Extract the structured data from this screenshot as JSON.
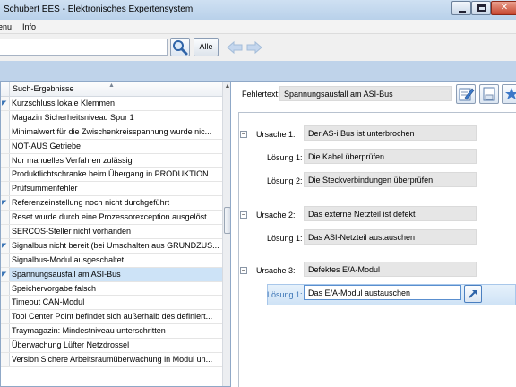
{
  "window": {
    "title": "Schubert EES - Elektronisches Expertensystem"
  },
  "menu": {
    "items": [
      "enu",
      "Info"
    ]
  },
  "toolbar": {
    "search_value": "",
    "all_label": "Alle"
  },
  "list": {
    "header": "Such-Ergebnisse",
    "items": [
      "Kurzschluss lokale Klemmen",
      "Magazin Sicherheitsniveau Spur 1",
      "Minimalwert für die Zwischenkreisspannung wurde nic...",
      "NOT-AUS Getriebe",
      "Nur manuelles Verfahren zulässig",
      "Produktlichtschranke beim Übergang in PRODUKTION...",
      "Prüfsummenfehler",
      "Referenzeinstellung noch nicht durchgeführt",
      "Reset wurde durch eine Prozessorexception ausgelöst",
      "SERCOS-Steller nicht vorhanden",
      "Signalbus nicht bereit (bei Umschalten aus GRUNDZUS...",
      "Signalbus-Modul ausgeschaltet",
      "Spannungsausfall am ASI-Bus",
      "Speichervorgabe falsch",
      "Timeout CAN-Modul",
      "Tool Center Point befindet sich außerhalb des definiert...",
      "Traymagazin: Mindestniveau unterschritten",
      "Überwachung Lüfter Netzdrossel",
      "Version Sichere Arbeitsraumüberwachung in Modul un..."
    ],
    "selected_index": 12
  },
  "detail": {
    "fehlertext_label": "Fehlertext:",
    "fehlertext_value": "Spannungsausfall am ASI-Bus",
    "causes": [
      {
        "label": "Ursache 1:",
        "value": "Der AS-i Bus ist unterbrochen",
        "solutions": [
          {
            "label": "Lösung 1:",
            "value": "Die Kabel überprüfen"
          },
          {
            "label": "Lösung 2:",
            "value": "Die Steckverbindungen überprüfen"
          }
        ]
      },
      {
        "label": "Ursache 2:",
        "value": "Das externe Netzteil ist defekt",
        "solutions": [
          {
            "label": "Lösung 1:",
            "value": "Das ASI-Netzteil austauschen"
          }
        ]
      },
      {
        "label": "Ursache 3:",
        "value": "Defektes E/A-Modul",
        "solutions": [
          {
            "label": "Lösung 1:",
            "value": "Das E/A-Modul austauschen"
          }
        ]
      }
    ]
  },
  "colors": {
    "accent": "#3b74b5",
    "selection": "#cde3f7",
    "field": "#e6e6e6",
    "chrome": "#bfd3ea"
  }
}
